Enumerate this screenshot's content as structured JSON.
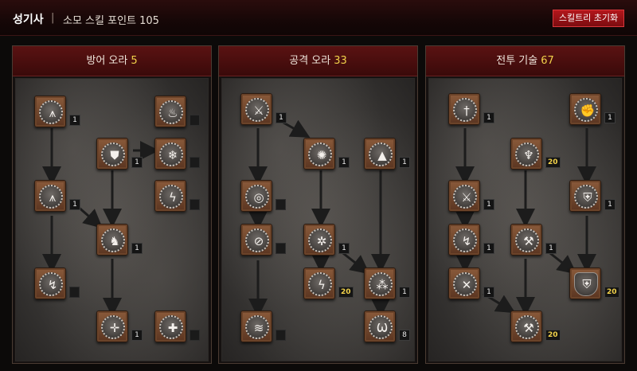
{
  "header": {
    "title": "성기사",
    "separator": "|",
    "points_label": "소모 스킬 포인트 105",
    "reset_label": "스킬트리 초기화"
  },
  "colors": {
    "accent": "#b3161b",
    "points": "#f2d24a",
    "panel_head": "#4a0e0e"
  },
  "trees": [
    {
      "name": "방어 오라",
      "points": "5",
      "skills": [
        {
          "icon": "shield-spike-icon",
          "level": "1"
        },
        {
          "icon": "flame-crown-icon",
          "level": ""
        },
        {
          "icon": "shield-icon",
          "level": "1"
        },
        {
          "icon": "snowflake-icon",
          "level": ""
        },
        {
          "icon": "spike-icon",
          "level": "1"
        },
        {
          "icon": "lightning-bolt-icon",
          "level": ""
        },
        {
          "icon": "dragon-head-icon",
          "level": "1"
        },
        {
          "icon": "lightning-wave-icon",
          "level": ""
        },
        {
          "icon": "compass-cross-icon",
          "level": "1"
        },
        {
          "icon": "cross-star-icon",
          "level": ""
        }
      ]
    },
    {
      "name": "공격 오라",
      "points": "33",
      "skills": [
        {
          "icon": "sword-slash-icon",
          "level": "1"
        },
        {
          "icon": "flame-claw-icon",
          "level": "1"
        },
        {
          "icon": "pyramid-icon",
          "level": "1"
        },
        {
          "icon": "concentric-rings-icon",
          "level": ""
        },
        {
          "icon": "crossed-circle-icon",
          "level": ""
        },
        {
          "icon": "snowflake-wheel-icon",
          "level": "1"
        },
        {
          "icon": "lightning-orb-icon",
          "level": "20"
        },
        {
          "icon": "trinity-orb-icon",
          "level": "1"
        },
        {
          "icon": "vortex-icon",
          "level": ""
        },
        {
          "icon": "fang-icon",
          "level": "8"
        }
      ]
    },
    {
      "name": "전투 기술",
      "points": "67",
      "skills": [
        {
          "icon": "sword-icon",
          "level": "1"
        },
        {
          "icon": "fist-shield-icon",
          "level": "1"
        },
        {
          "icon": "holy-fire-icon",
          "level": "20"
        },
        {
          "icon": "crossed-swords-icon",
          "level": "1"
        },
        {
          "icon": "charging-shield-icon",
          "level": "1"
        },
        {
          "icon": "lightning-fist-icon",
          "level": "1"
        },
        {
          "icon": "hammer-icon",
          "level": "1"
        },
        {
          "icon": "crossed-blades-icon",
          "level": "1"
        },
        {
          "icon": "cross-shield-icon",
          "level": "20"
        },
        {
          "icon": "flying-hammer-icon",
          "level": "20"
        }
      ]
    }
  ]
}
